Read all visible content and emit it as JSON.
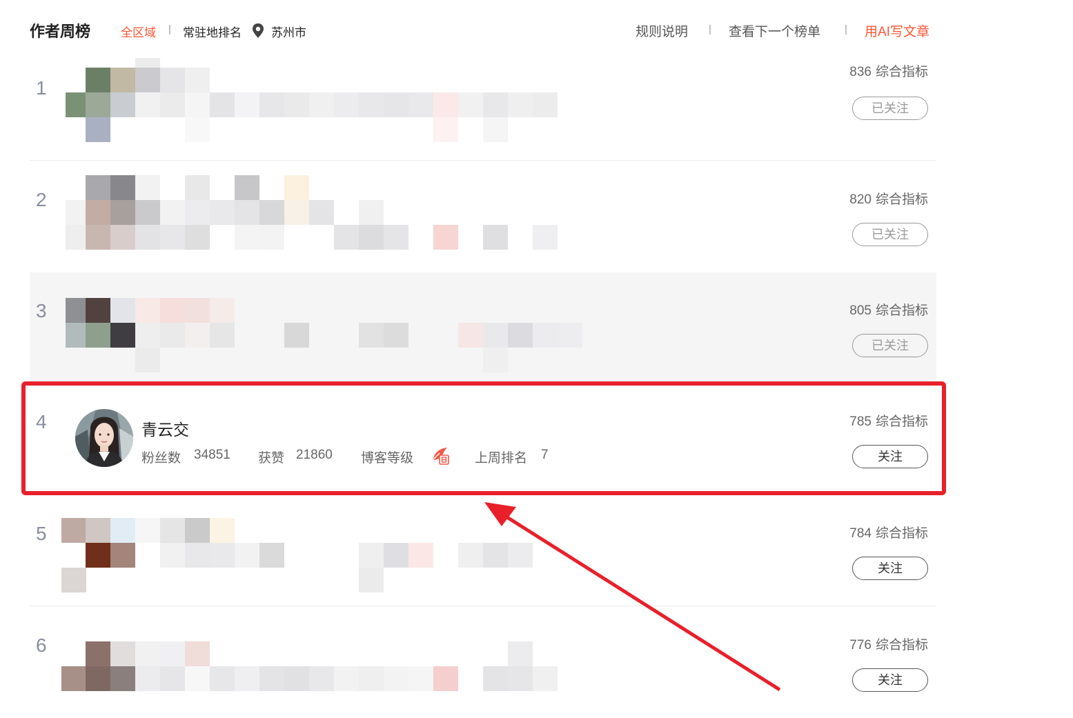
{
  "header": {
    "title": "作者周榜",
    "region": "全区域",
    "separator": "|",
    "resident_rank": "常驻地排名",
    "location_icon": "location-pin-icon",
    "city": "苏州市",
    "links": [
      "规则说明",
      "查看下一个榜单",
      "用AI写文章"
    ]
  },
  "score_label": "综合指标",
  "rows": [
    {
      "rank": "1",
      "score": "836",
      "button": "已关注"
    },
    {
      "rank": "2",
      "score": "820",
      "button": "已关注"
    },
    {
      "rank": "3",
      "score": "805",
      "button": "已关注"
    },
    {
      "rank": "4",
      "score": "785",
      "button": "关注",
      "name": "青云交",
      "fans_label": "粉丝数",
      "fans": "34851",
      "likes_label": "获赞",
      "likes": "21860",
      "level_label": "博客等级",
      "level_icon": "blog-level-icon",
      "last_week_label": "上周排名",
      "last_week": "7"
    },
    {
      "rank": "5",
      "score": "784",
      "button": "关注"
    },
    {
      "rank": "6",
      "score": "776",
      "button": "关注"
    }
  ],
  "colors": {
    "accent": "#fc5531",
    "annotation": "#e8202a"
  }
}
